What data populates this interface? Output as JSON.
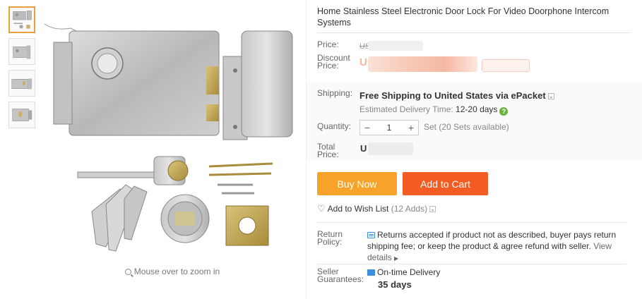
{
  "product": {
    "title": "Home Stainless Steel Electronic Door Lock For Video Doorphone Intercom Systems",
    "zoom_hint": "Mouse over to zoom in"
  },
  "labels": {
    "price": "Price:",
    "discount_price_1": "Discount",
    "discount_price_2": "Price:",
    "shipping": "Shipping:",
    "quantity": "Quantity:",
    "total_price_1": "Total",
    "total_price_2": "Price:",
    "return_policy_1": "Return",
    "return_policy_2": "Policy:",
    "seller_guarantees_1": "Seller",
    "seller_guarantees_2": "Guarantees:"
  },
  "price": {
    "original_prefix": "US",
    "discount_prefix": "U",
    "total_prefix": "U"
  },
  "shipping": {
    "free_text": "Free Shipping to United States via ePacket",
    "estimated_label": "Estimated Delivery Time:",
    "estimated_days": "12-20 days",
    "help_glyph": "?"
  },
  "quantity": {
    "minus": "−",
    "value": "1",
    "plus": "+",
    "info": "Set (20 Sets available)"
  },
  "actions": {
    "buy_now": "Buy Now",
    "add_to_cart": "Add to Cart",
    "wishlist": "Add to Wish List",
    "wishlist_count": "(12 Adds)"
  },
  "return_policy": {
    "text": "Returns accepted if product not as described, buyer pays return shipping fee; or keep the product & agree refund with seller.",
    "view_details": "View details"
  },
  "guarantees": {
    "delivery": "On-time Delivery",
    "days": "35 days"
  },
  "colors": {
    "buy_now": "#f7a32a",
    "add_to_cart": "#f35d23",
    "help": "#6bb33f",
    "accent": "#3a8edc",
    "active_thumb": "#e8a23a"
  }
}
